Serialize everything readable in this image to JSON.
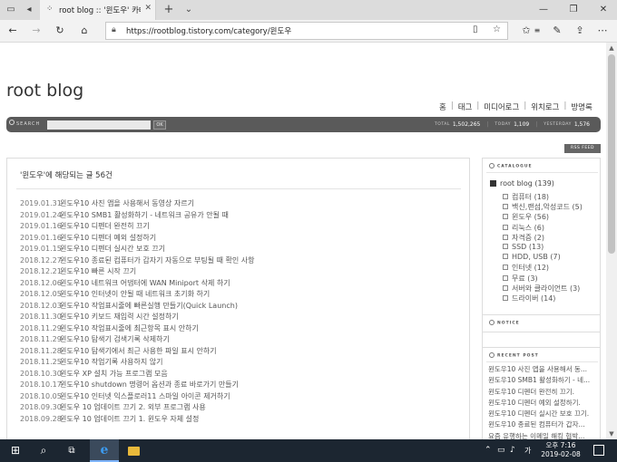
{
  "browser": {
    "tab_title": "root blog :: '윈도우' 카테",
    "url": "https://rootblog.tistory.com/category/윈도우"
  },
  "blog": {
    "title": "root blog",
    "menu": [
      "홈",
      "태그",
      "미디어로그",
      "위치로그",
      "방명록"
    ],
    "search_label": "SEARCH",
    "search_ok": "OK",
    "stats": {
      "total_label": "TOTAL",
      "total": "1,502,265",
      "today_label": "TODAY",
      "today": "1,109",
      "yesterday_label": "YESTERDAY",
      "yesterday": "1,576"
    },
    "rss_label": "RSS FEED"
  },
  "content": {
    "heading": "'윈도우'에 해당되는 글 56건",
    "posts": [
      {
        "date": "2019.01.31",
        "title": "윈도우10 사진 앱을 사용해서 동영상 자르기"
      },
      {
        "date": "2019.01.24",
        "title": "윈도우10 SMB1 활성화하기 - 네트워크 공유가 안될 때"
      },
      {
        "date": "2019.01.16",
        "title": "윈도우10 디펜더 완전히 끄기"
      },
      {
        "date": "2019.01.16",
        "title": "윈도우10 디펜더 예외 설정하기"
      },
      {
        "date": "2019.01.15",
        "title": "윈도우10 디펜더 실시간 보호 끄기"
      },
      {
        "date": "2018.12.27",
        "title": "윈도우10 종료된 컴퓨터가 갑자기 자동으로 부팅될 때 확인 사항"
      },
      {
        "date": "2018.12.21",
        "title": "윈도우10 빠른 시작 끄기"
      },
      {
        "date": "2018.12.06",
        "title": "윈도우10 네트워크 어댑터에 WAN Miniport 삭제 하기"
      },
      {
        "date": "2018.12.05",
        "title": "윈도우10 인터넷이 안될 때 네트워크 초기화 하기"
      },
      {
        "date": "2018.12.03",
        "title": "윈도우10 작업표시줄에 빠른실행 만들기(Quick Launch)"
      },
      {
        "date": "2018.11.30",
        "title": "윈도우10 키보드 재입력 시간 설정하기"
      },
      {
        "date": "2018.11.29",
        "title": "윈도우10 작업표시줄에 최근항목 표시 안하기"
      },
      {
        "date": "2018.11.29",
        "title": "윈도우10 탐색기 검색기록 삭제하기"
      },
      {
        "date": "2018.11.28",
        "title": "윈도우10 탐색기에서 최근 사용한 파일 표시 안하기"
      },
      {
        "date": "2018.11.25",
        "title": "윈도우10 작업기록 사용하지 않기"
      },
      {
        "date": "2018.10.30",
        "title": "윈도우 XP 설치 가능 프로그램 모음"
      },
      {
        "date": "2018.10.17",
        "title": "윈도우10 shutdown 명령어 옵션과 종료 바로가기 만들기"
      },
      {
        "date": "2018.10.05",
        "title": "윈도우10 인터넷 익스플로러11 스마일 아이콘 제거하기"
      },
      {
        "date": "2018.09.30",
        "title": "윈도우 10 업데이트 끄기 2. 외부 프로그램 사용"
      },
      {
        "date": "2018.09.28",
        "title": "윈도우 10 업데이트 끄기 1. 윈도우 자체 설정"
      }
    ]
  },
  "sidebar": {
    "catalogue_title": "CATALOGUE",
    "root_category": "root blog (139)",
    "categories": [
      "컴퓨터 (18)",
      "백신,랜섬,악성코드 (5)",
      "윈도우 (56)",
      "리눅스 (6)",
      "자격증 (2)",
      "SSD (13)",
      "HDD, USB (7)",
      "인터넷 (12)",
      "무료 (3)",
      "서버와 클라이언트 (3)",
      "드라이버 (14)"
    ],
    "notice_title": "NOTICE",
    "recent_title": "RECENT POST",
    "recent_posts": [
      "윈도우10 사진 앱을 사용해서 동...",
      "윈도우10 SMB1 활성화하기 - 네...",
      "윈도우10 디펜더 완전히 끄기.",
      "윈도우10 디펜더 예외 설정하기.",
      "윈도우10 디펜더 실시간 보호 끄기.",
      "윈도우10 종료된 컴퓨터가 갑자...",
      "요즘 유행하는 이메일 해킹 협박...",
      "윈도우10 종료된 컴퓨터가 갑자기..."
    ]
  },
  "taskbar": {
    "time": "오후 7:16",
    "date": "2019-02-08",
    "ime": "가"
  }
}
